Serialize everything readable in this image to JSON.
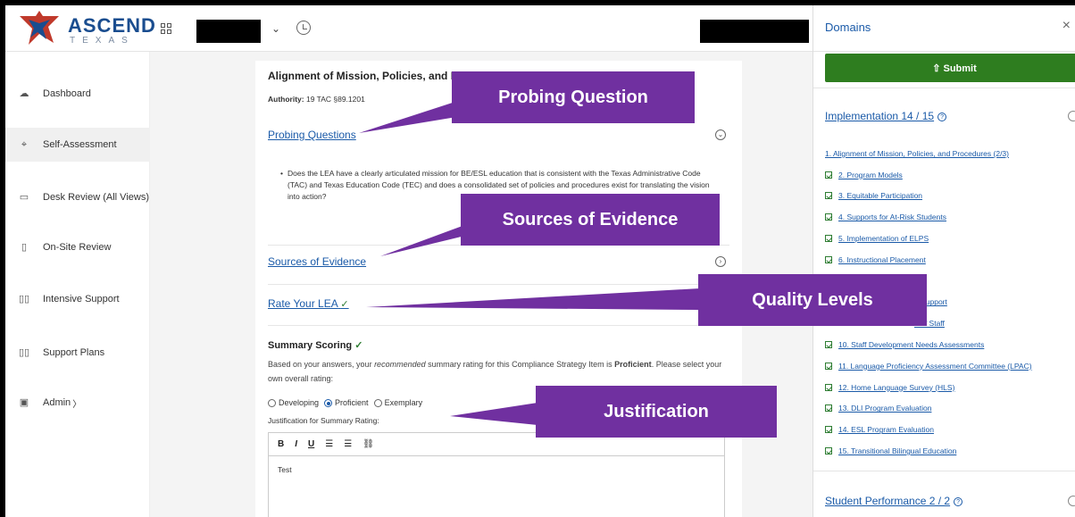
{
  "logo": {
    "title": "ASCEND",
    "subtitle": "TEXAS"
  },
  "topbar": {
    "dropdown_chevron": "⌄"
  },
  "sidebar": {
    "items": [
      {
        "label": "Dashboard",
        "icon": "cloud-icon",
        "glyph": "☁"
      },
      {
        "label": "Self-Assessment",
        "icon": "crosshair-icon",
        "glyph": "⌖"
      },
      {
        "label": "Desk Review (All Views)",
        "icon": "monitor-icon",
        "glyph": "▭"
      },
      {
        "label": "On-Site Review",
        "icon": "clipboard-icon",
        "glyph": "▯"
      },
      {
        "label": "Intensive Support",
        "icon": "book-icon",
        "glyph": "▯▯"
      },
      {
        "label": "Support Plans",
        "icon": "map-icon",
        "glyph": "▯▯"
      },
      {
        "label": "Admin",
        "icon": "id-card-icon",
        "glyph": "▣",
        "suffix": "〉"
      }
    ],
    "active_index": 1
  },
  "main": {
    "title": "Alignment of Mission, Policies, and Procedures",
    "authority_label": "Authority:",
    "authority_value": "19 TAC §89.1201",
    "probing_link": "Probing Questions",
    "probing_bullet": "Does the LEA have a clearly articulated mission for BE/ESL education that is consistent with the Texas Administrative Code (TAC) and Texas Education Code (TEC) and does a consolidated set of policies and procedures exist for translating the vision into action?",
    "sources_link": "Sources of Evidence",
    "rate_link": "Rate Your LEA",
    "check_mark": "✓",
    "summary_title": "Summary Scoring",
    "summary_text_1": "Based on your answers, your ",
    "summary_text_em": "recommended",
    "summary_text_2": " summary rating for this Compliance Strategy Item is ",
    "summary_text_bold": "Proficient",
    "summary_text_3": ". Please select your own overall rating:",
    "ratings": [
      "Developing",
      "Proficient",
      "Exemplary"
    ],
    "selected_rating": "Proficient",
    "justification_label": "Justification for Summary Rating:",
    "toolbar": [
      "B",
      "I",
      "U",
      "☰",
      "☰",
      "⛓"
    ],
    "editor_text": "Test"
  },
  "callouts": {
    "probing": "Probing Question",
    "sources": "Sources of Evidence",
    "quality": "Quality Levels",
    "justification": "Justification"
  },
  "panel": {
    "title": "Domains",
    "close": "×",
    "submit": "⇧ Submit",
    "section1": "Implementation 14 / 15",
    "section2": "Student Performance 2 / 2",
    "help_glyph": "?",
    "domains": [
      {
        "label": "1. Alignment of Mission, Policies, and Procedures (2/3)",
        "checked": false
      },
      {
        "label": "2. Program Models",
        "checked": true
      },
      {
        "label": "3. Equitable Participation",
        "checked": true
      },
      {
        "label": "4. Supports for At-Risk Students",
        "checked": true
      },
      {
        "label": "5. Implementation of ELPS",
        "checked": true
      },
      {
        "label": "6. Instructional Placement",
        "checked": true
      },
      {
        "label": "",
        "checked": false
      },
      {
        "label": "d Support",
        "checked": false
      },
      {
        "label": "n of Staff",
        "checked": false
      },
      {
        "label": "10. Staff Development Needs Assessments",
        "checked": true
      },
      {
        "label": "11. Language Proficiency Assessment Committee (LPAC)",
        "checked": true
      },
      {
        "label": "12. Home Language Survey (HLS)",
        "checked": true
      },
      {
        "label": "13. DLI Program Evaluation",
        "checked": true
      },
      {
        "label": "14. ESL Program Evaluation",
        "checked": true
      },
      {
        "label": "15. Transitional Bilingual Education",
        "checked": true
      }
    ]
  },
  "colors": {
    "accent": "#1a5aa8",
    "callout": "#7030a0",
    "submit": "#2e7d1f"
  }
}
